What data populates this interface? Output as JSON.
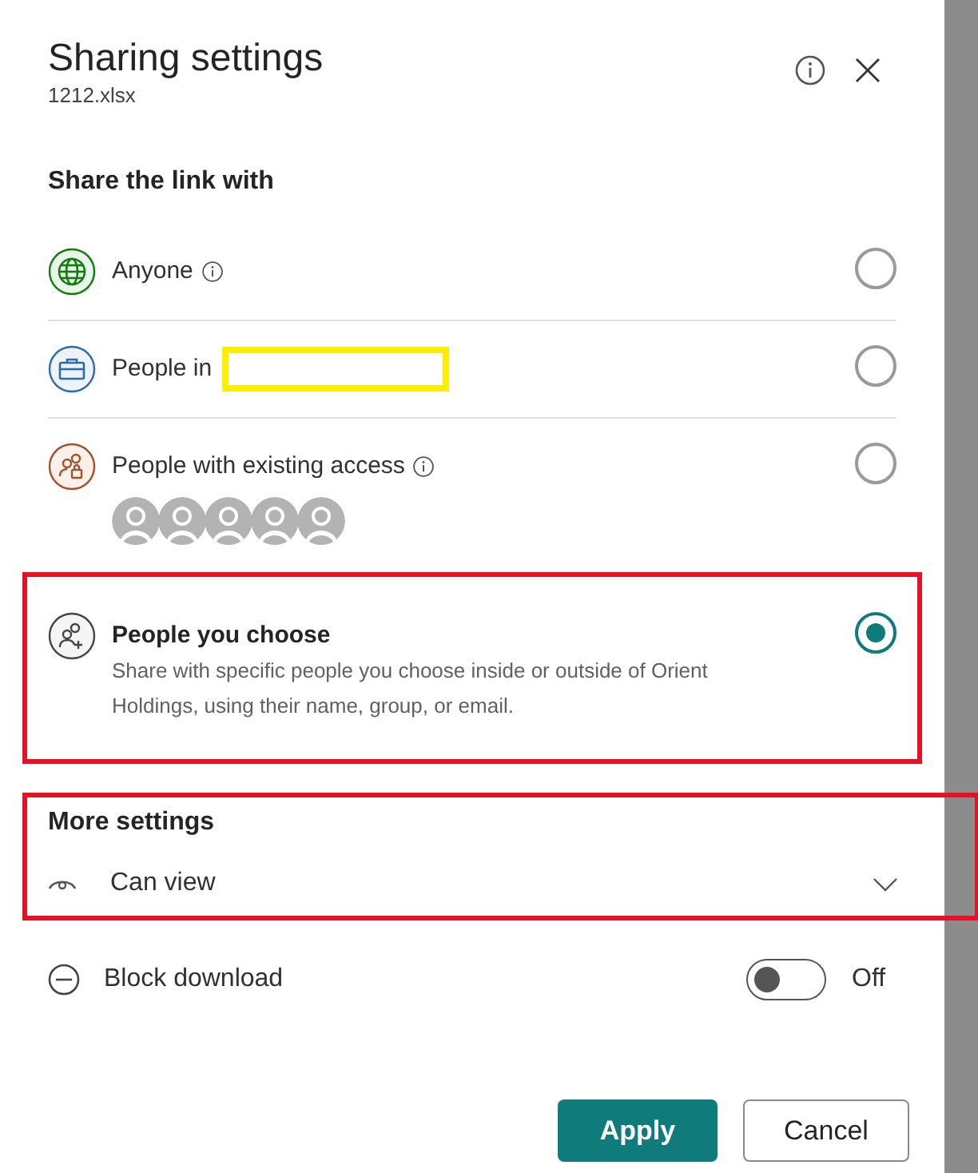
{
  "dialog": {
    "title": "Sharing settings",
    "subtitle": "1212.xlsx"
  },
  "share_section": {
    "heading": "Share the link with",
    "options": [
      {
        "kind": "globe",
        "label": "Anyone",
        "info": true,
        "selected": false,
        "highlighted": false,
        "redacted": false
      },
      {
        "kind": "briefcase",
        "label": "People in",
        "info": false,
        "selected": false,
        "highlighted": false,
        "redacted": true
      },
      {
        "kind": "people-lock",
        "label": "People with existing access",
        "info": true,
        "selected": false,
        "highlighted": false,
        "redacted": false,
        "avatars": [
          {
            "kind": "person"
          },
          {
            "kind": "person"
          },
          {
            "kind": "person"
          },
          {
            "kind": "person"
          },
          {
            "kind": "person"
          }
        ]
      },
      {
        "kind": "people-add",
        "label": "People you choose",
        "description": "Share with specific people you choose inside or outside of Orient Holdings, using their name, group, or email.",
        "info": false,
        "selected": true,
        "highlighted": true,
        "redacted": false
      }
    ]
  },
  "more_settings": {
    "heading": "More settings",
    "highlighted": true,
    "permission": "Can view"
  },
  "block_download": {
    "label": "Block download",
    "on": false,
    "state_text": "Off"
  },
  "buttons": [
    {
      "kind": "primary",
      "label": "Apply"
    },
    {
      "kind": "secondary",
      "label": "Cancel"
    }
  ]
}
